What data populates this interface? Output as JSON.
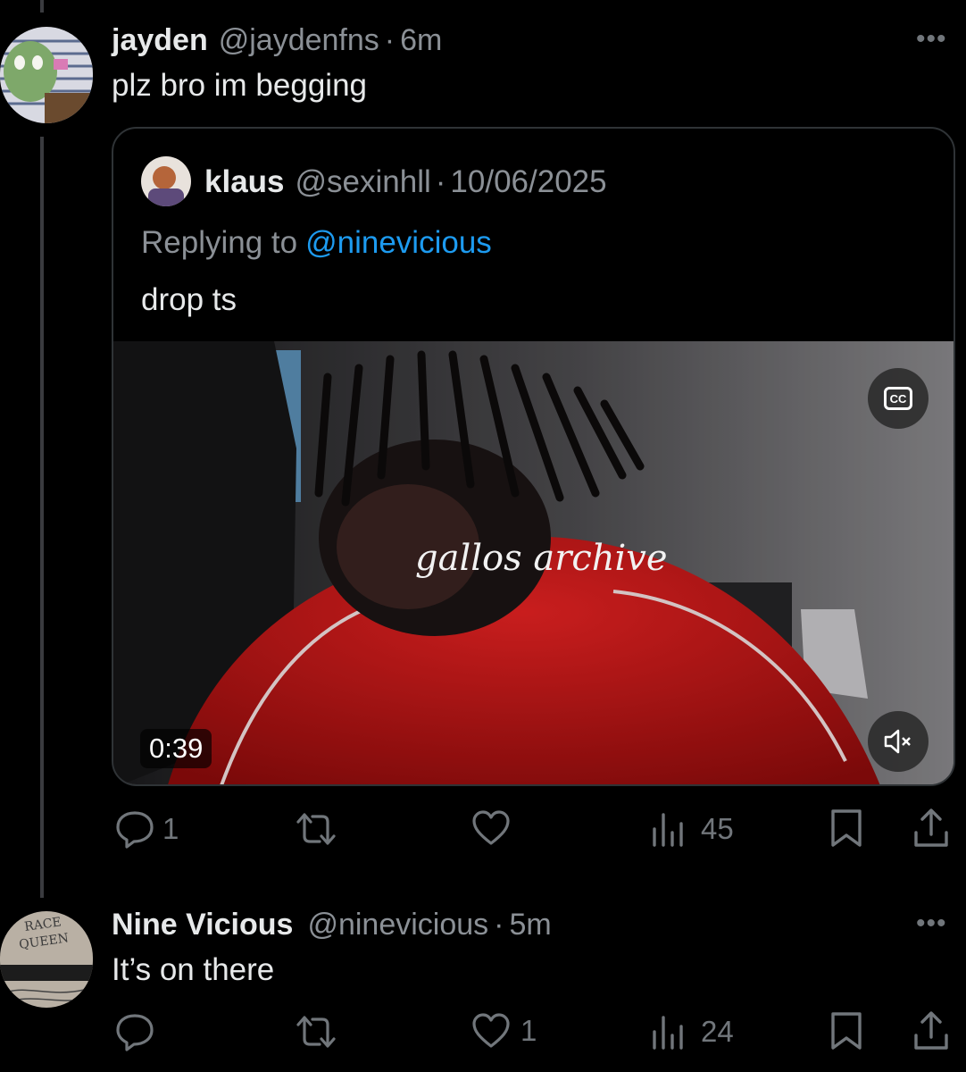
{
  "reply1": {
    "display_name": "jayden",
    "handle": "@jaydenfns",
    "time": "6m",
    "text": "plz bro im begging",
    "more_icon": "ellipsis-icon"
  },
  "quote": {
    "display_name": "klaus",
    "handle": "@sexinhll",
    "date": "10/06/2025",
    "replying_prefix": "Replying to",
    "replying_handle": "@ninevicious",
    "text": "drop ts",
    "video": {
      "duration": "0:39",
      "watermark": "gallos archive",
      "cc_label": "CC"
    }
  },
  "reply1_actions": {
    "replies": "1",
    "retweets": "",
    "likes": "",
    "views": "45"
  },
  "reply2": {
    "display_name": "Nine Vicious",
    "handle": "@ninevicious",
    "time": "5m",
    "text": "It’s on there"
  },
  "reply2_actions": {
    "replies": "",
    "retweets": "",
    "likes": "1",
    "views": "24"
  },
  "colors": {
    "background": "#000000",
    "text": "#e7e9ea",
    "muted": "#71767b",
    "link": "#1d9bf0",
    "border": "#2f3336"
  }
}
